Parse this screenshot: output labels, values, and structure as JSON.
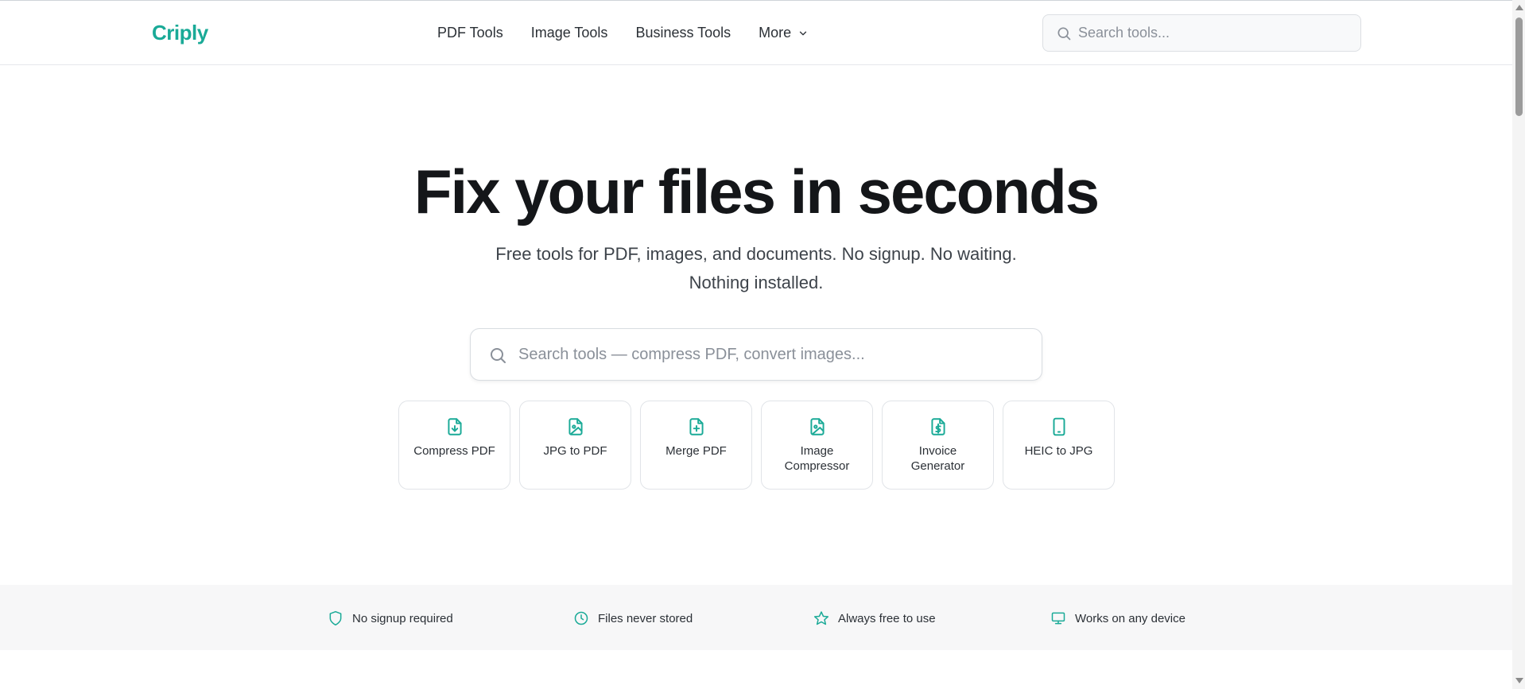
{
  "header": {
    "logo": "Criply",
    "nav": [
      {
        "label": "PDF Tools"
      },
      {
        "label": "Image Tools"
      },
      {
        "label": "Business Tools"
      },
      {
        "label": "More",
        "icon": "chevron-down-icon"
      }
    ],
    "search_placeholder": "Search tools..."
  },
  "hero": {
    "title": "Fix your files in seconds",
    "subtitle_line1": "Free tools for PDF, images, and documents. No signup. No waiting.",
    "subtitle_line2": "Nothing installed.",
    "search_placeholder": "Search tools — compress PDF, convert images..."
  },
  "tools": [
    {
      "label": "Compress PDF",
      "icon": "file-download-icon"
    },
    {
      "label": "JPG to PDF",
      "icon": "file-image-icon"
    },
    {
      "label": "Merge PDF",
      "icon": "file-plus-icon"
    },
    {
      "label": "Image Compressor",
      "icon": "file-image-icon"
    },
    {
      "label": "Invoice Generator",
      "icon": "file-dollar-icon"
    },
    {
      "label": "HEIC to JPG",
      "icon": "smartphone-icon"
    }
  ],
  "features": [
    {
      "label": "No signup required",
      "icon": "shield-icon"
    },
    {
      "label": "Files never stored",
      "icon": "clock-icon"
    },
    {
      "label": "Always free to use",
      "icon": "star-icon"
    },
    {
      "label": "Works on any device",
      "icon": "monitor-icon"
    }
  ],
  "colors": {
    "accent": "#1aaa97",
    "text": "#1f2328",
    "feature_bg": "#f7f7f8"
  }
}
